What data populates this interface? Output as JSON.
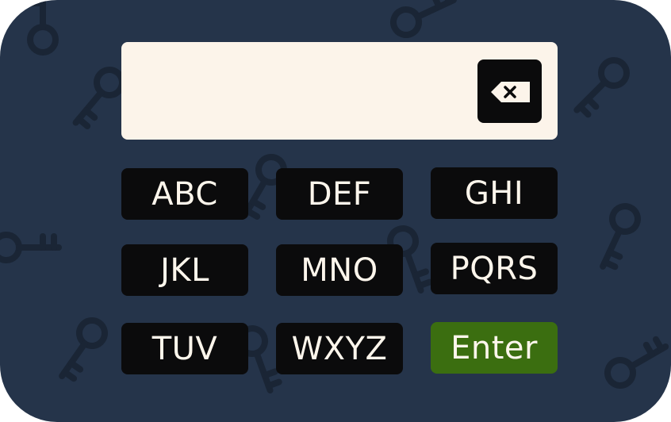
{
  "keypad": {
    "display_value": "",
    "backspace_icon": "backspace-icon",
    "keys": [
      {
        "label": "ABC"
      },
      {
        "label": "DEF"
      },
      {
        "label": "GHI"
      },
      {
        "label": "JKL"
      },
      {
        "label": "MNO"
      },
      {
        "label": "PQRS"
      },
      {
        "label": "TUV"
      },
      {
        "label": "WXYZ"
      },
      {
        "label": "Enter"
      }
    ]
  },
  "colors": {
    "panel": "#25344a",
    "display": "#fcf4ea",
    "key": "#0b0b0c",
    "key_text": "#fdf6ec",
    "enter": "#3b6e10",
    "background_keys": "#1a2535"
  }
}
